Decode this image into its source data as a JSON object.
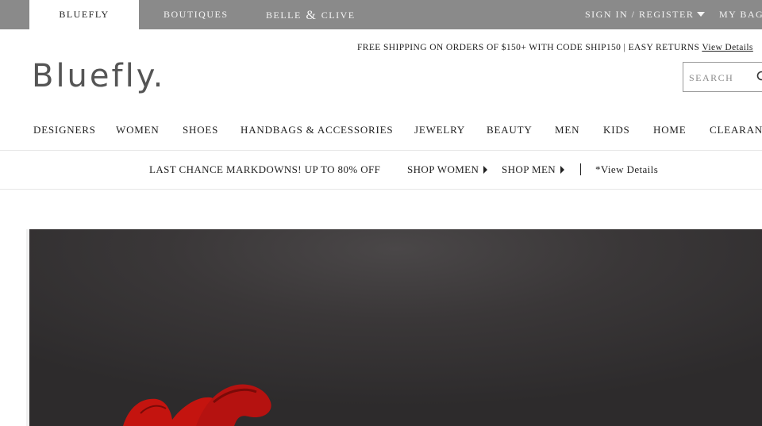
{
  "topbar": {
    "tabs": [
      {
        "label": "BLUEFLY",
        "active": true
      },
      {
        "label": "BOUTIQUES",
        "active": false
      }
    ],
    "belle_clive": {
      "part1": "BELLE",
      "amp": "&",
      "part2": "CLIVE"
    },
    "sign_in": "SIGN IN / REGISTER",
    "my_bag": "MY BAG"
  },
  "header": {
    "promo_text": "FREE SHIPPING ON ORDERS OF $150+ WITH CODE SHIP150 | EASY RETURNS",
    "promo_link": "View Details",
    "logo": "Bluefly.",
    "search_placeholder": "SEARCH",
    "search_icon": "search-icon"
  },
  "nav": {
    "items": [
      "DESIGNERS",
      "WOMEN",
      "SHOES",
      "HANDBAGS & ACCESSORIES",
      "JEWELRY",
      "BEAUTY",
      "MEN",
      "KIDS",
      "HOME",
      "CLEARANCE"
    ]
  },
  "markdowns": {
    "headline": "LAST CHANCE MARKDOWNS! UP TO 80% OFF",
    "shop_women": "SHOP WOMEN",
    "shop_men": "SHOP MEN",
    "details": "*View Details"
  },
  "colors": {
    "topbar_bg": "#8a8a8a",
    "logo": "#555555",
    "hero_bg": "#3a3738",
    "ribbon": "#c4140f"
  }
}
